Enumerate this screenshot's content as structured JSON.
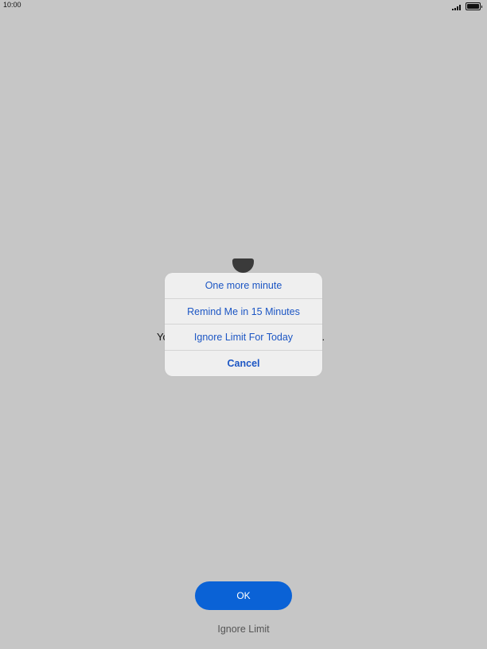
{
  "status_bar": {
    "time": "10:00",
    "signal_icon": "signal-icon",
    "battery_icon": "battery-icon"
  },
  "screen_time": {
    "icon": "hourglass-icon",
    "message_left": "Yo",
    "message_right": "k."
  },
  "action_sheet": {
    "items": [
      {
        "label": "One more minute"
      },
      {
        "label": "Remind Me in 15 Minutes"
      },
      {
        "label": "Ignore Limit For Today"
      },
      {
        "label": "Cancel"
      }
    ]
  },
  "footer": {
    "ok_label": "OK",
    "ignore_limit_label": "Ignore Limit"
  },
  "colors": {
    "background": "#c6c6c6",
    "accent": "#0a62d6",
    "action_text": "#1c56c4"
  }
}
